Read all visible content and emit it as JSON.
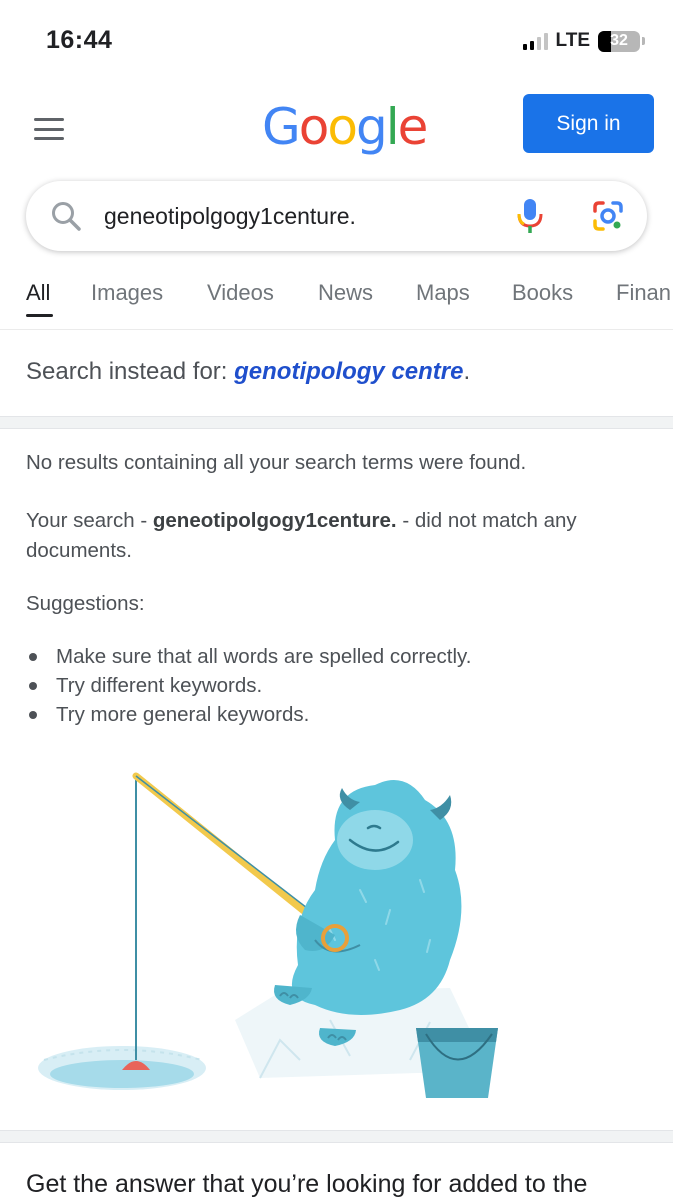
{
  "status_bar": {
    "time": "16:44",
    "network": "LTE",
    "battery": "32",
    "battery_level": 0.32
  },
  "header": {
    "logo_letters": [
      "G",
      "o",
      "o",
      "g",
      "l",
      "e"
    ],
    "logo_colors": [
      "#4285F4",
      "#EA4335",
      "#FBBC05",
      "#4285F4",
      "#34A853",
      "#EA4335"
    ],
    "sign_in_label": "Sign in",
    "accent_color": "#1a73e8"
  },
  "search": {
    "value": "geneotipolgogy1centure.",
    "icons": [
      "search-icon",
      "mic-icon",
      "lens-icon"
    ]
  },
  "tabs": [
    {
      "label": "All",
      "active": true
    },
    {
      "label": "Images"
    },
    {
      "label": "Videos"
    },
    {
      "label": "News"
    },
    {
      "label": "Maps"
    },
    {
      "label": "Books"
    },
    {
      "label": "Finan"
    }
  ],
  "spelling": {
    "prefix": "Search instead for: ",
    "suggestion": "genotipology centre",
    "suffix": "."
  },
  "no_results": {
    "line1": "No results containing all your search terms were found.",
    "your_search_prefix": "Your search - ",
    "query": "geneotipolgogy1centure.",
    "your_search_suffix": " - did not match any documents.",
    "suggestions_label": "Suggestions:",
    "suggestions": [
      "Make sure that all words are spelled correctly.",
      "Try different keywords.",
      "Try more general keywords."
    ]
  },
  "footer": {
    "text": "Get the answer that you’re looking for added to the"
  }
}
